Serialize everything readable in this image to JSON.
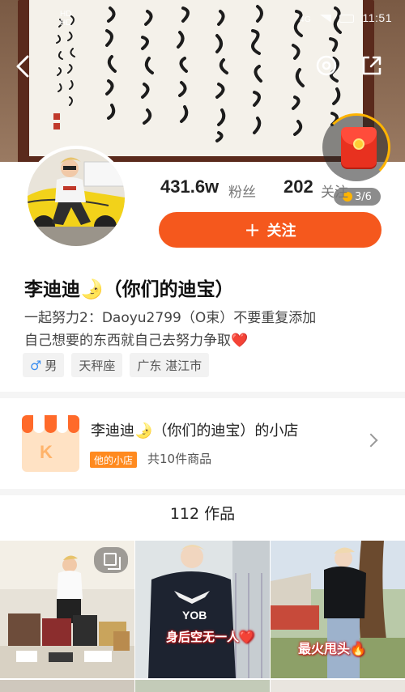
{
  "status_bar": {
    "left_top": "HD",
    "left_bottom": "HD",
    "network": "4G",
    "time": "11:51"
  },
  "profile": {
    "fans_count": "431.6w",
    "fans_label": "粉丝",
    "following_count": "202",
    "following_label": "关注",
    "follow_button_label": "关注",
    "name": "李迪迪🌛（你们的迪宝）",
    "bio_line1": "一起努力2：Daoyu2799（O束）不要重复添加",
    "bio_line2": "自己想要的东西就自己去努力争取❤️",
    "tags": {
      "gender_symbol": "♂",
      "gender": "男",
      "zodiac": "天秤座",
      "location": "广东 湛江市"
    }
  },
  "red_packet": {
    "progress": "3/6"
  },
  "store": {
    "title": "李迪迪🌛（你们的迪宝）的小店",
    "badge": "他的小店",
    "count": "共10件商品",
    "icon_letter": "K"
  },
  "works": {
    "count_label": "112 作品"
  },
  "grid": {
    "captions": [
      "",
      "身后空无一人❤️",
      "最火甩头🔥"
    ],
    "sweater_text": "YOB"
  },
  "icons": {
    "back": "chevron-left-icon",
    "share": "share-icon",
    "more": "settings-icon",
    "store_chevron": "chevron-right-icon",
    "multi_photo": "gallery-icon"
  },
  "colors": {
    "accent": "#f5581d",
    "store_badge": "#ff8a1f",
    "male_blue": "#3b8ef0"
  }
}
